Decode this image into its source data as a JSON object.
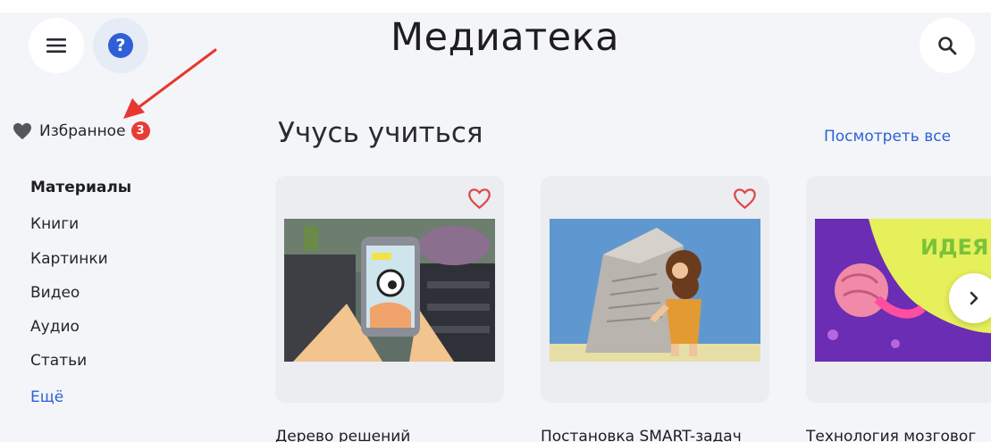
{
  "header": {
    "title": "Медиатека",
    "menu_icon": "hamburger-icon",
    "help_icon": "question-icon",
    "search_icon": "search-icon"
  },
  "sidebar": {
    "favorites_label": "Избранное",
    "favorites_count": "3",
    "section_heading": "Материалы",
    "items": [
      {
        "label": "Книги"
      },
      {
        "label": "Картинки"
      },
      {
        "label": "Видео"
      },
      {
        "label": "Аудио"
      },
      {
        "label": "Статьи"
      }
    ],
    "more_label": "Ещё"
  },
  "section": {
    "title": "Учусь учиться",
    "see_all_label": "Посмотреть все"
  },
  "cards": [
    {
      "title": "Дерево решений"
    },
    {
      "title": "Постановка SMART-задач"
    },
    {
      "title": "Технология мозговог"
    }
  ],
  "card3_image_text": "ИДЕЯ",
  "colors": {
    "accent": "#2f5fd8",
    "badge": "#e93b35",
    "heart": "#e04848",
    "annotation_arrow": "#e8372f"
  }
}
